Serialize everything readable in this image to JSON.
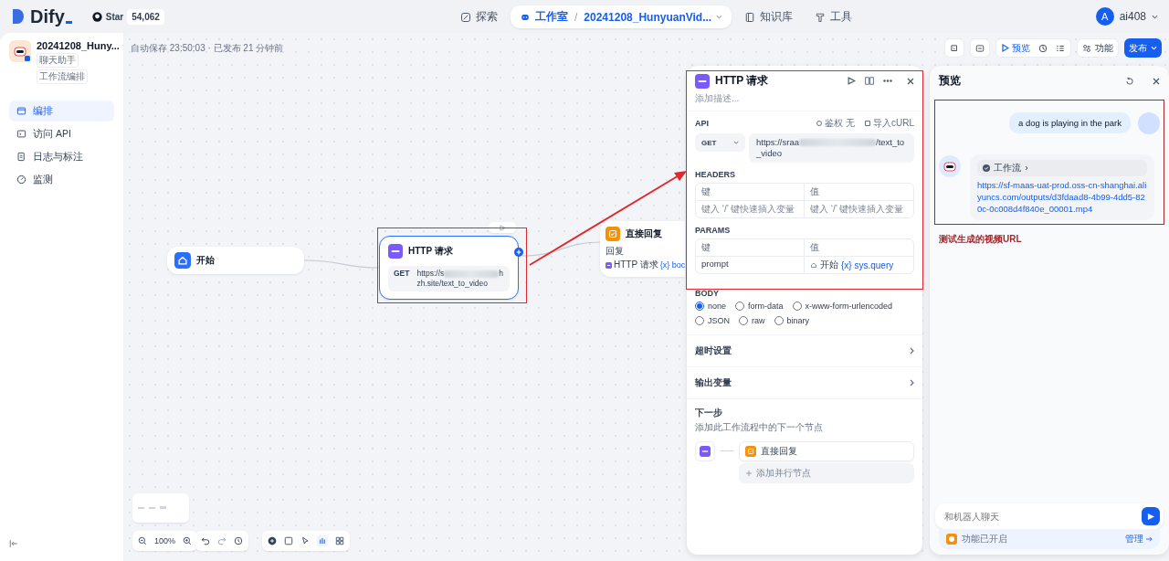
{
  "header": {
    "logo": "Dify",
    "github": {
      "label": "Star",
      "count": "54,062"
    },
    "nav": [
      {
        "label": "探索",
        "selected": false
      },
      {
        "label": "工作室",
        "selected": true,
        "separator": "/",
        "app": "20241208_HunyuanVid..."
      },
      {
        "label": "知识库",
        "selected": false
      },
      {
        "label": "工具",
        "selected": false
      }
    ],
    "user": {
      "initial": "A",
      "name": "ai408"
    }
  },
  "app": {
    "name": "20241208_Huny...",
    "tags": [
      "聊天助手",
      "工作流编排"
    ]
  },
  "sidebar": {
    "items": [
      {
        "label": "编排",
        "selected": true
      },
      {
        "label": "访问 API",
        "selected": false
      },
      {
        "label": "日志与标注",
        "selected": false
      },
      {
        "label": "监测",
        "selected": false
      }
    ]
  },
  "status": "自动保存 23:50:03 · 已发布 21 分钟前",
  "toolbar": {
    "preview": "预览",
    "features": "功能",
    "publish": "发布"
  },
  "canvas": {
    "start": {
      "title": "开始"
    },
    "http": {
      "title": "HTTP 请求",
      "method": "GET",
      "url_start": "https://s",
      "url_end": "hzh.site/text_to_video"
    },
    "reply": {
      "title": "直接回复",
      "label": "回复",
      "source": "HTTP 请求",
      "var": "{x} boc"
    },
    "zoom": "100%"
  },
  "http_panel": {
    "title": "HTTP 请求",
    "description_placeholder": "添加描述...",
    "api": {
      "label": "API",
      "auth": "鉴权 无",
      "import": "导入cURL",
      "method": "GET",
      "url_start": "https://sraa",
      "url_end": "/text_to_video"
    },
    "headers": {
      "label": "HEADERS",
      "columns": [
        "键",
        "值"
      ],
      "placeholders": [
        "键入 ‘/’ 键快速插入变量",
        "键入 ‘/’ 键快速插入变量"
      ]
    },
    "params": {
      "label": "PARAMS",
      "columns": [
        "键",
        "值"
      ],
      "rows": [
        {
          "key": "prompt",
          "source": "开始",
          "var_mark": "{x}",
          "variable": "sys.query"
        }
      ]
    },
    "body": {
      "label": "BODY",
      "options": [
        {
          "label": "none",
          "selected": true
        },
        {
          "label": "form-data",
          "selected": false
        },
        {
          "label": "x-www-form-urlencoded",
          "selected": false
        },
        {
          "label": "JSON",
          "selected": false
        },
        {
          "label": "raw",
          "selected": false
        },
        {
          "label": "binary",
          "selected": false
        }
      ]
    },
    "sections": [
      "超时设置",
      "输出变量"
    ],
    "next": {
      "title": "下一步",
      "description": "添加此工作流程中的下一个节点",
      "node": "直接回复",
      "add": "添加并行节点"
    }
  },
  "preview": {
    "title": "预览",
    "user_message": "a dog is playing in the park",
    "workflow": "工作流",
    "answer": "https://sf-maas-uat-prod.oss-cn-shanghai.aliyuncs.com/outputs/d3fdaad8-4b99-4dd5-820c-0c008d4f840e_00001.mp4",
    "input_placeholder": "和机器人聊天",
    "features": "功能已开启",
    "manage": "管理"
  },
  "annotation": "测试生成的视频URL"
}
